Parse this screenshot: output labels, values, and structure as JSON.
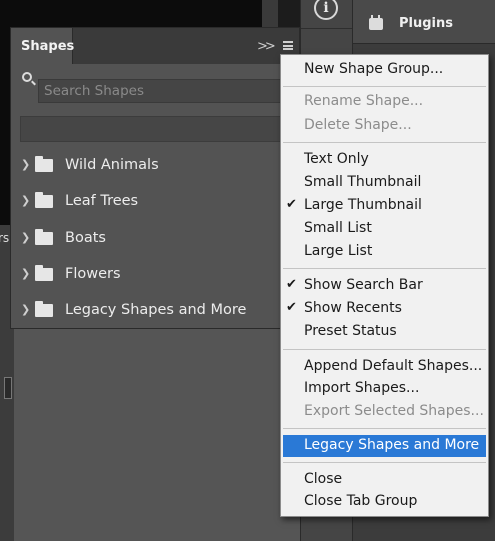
{
  "shapes_panel": {
    "tab_label": "Shapes",
    "search_placeholder": "Search Shapes",
    "groups": [
      {
        "label": "Wild Animals"
      },
      {
        "label": "Leaf Trees"
      },
      {
        "label": "Boats"
      },
      {
        "label": "Flowers"
      },
      {
        "label": "Legacy Shapes and More"
      }
    ]
  },
  "plugins_panel": {
    "label": "Plugins"
  },
  "left_fragment": {
    "text": "rs"
  },
  "context_menu": {
    "items": [
      {
        "label": "New Shape Group...",
        "enabled": true,
        "checked": false
      },
      {
        "label": "Rename Shape...",
        "enabled": false,
        "checked": false
      },
      {
        "label": "Delete Shape...",
        "enabled": false,
        "checked": false
      },
      {
        "label": "Text Only",
        "enabled": true,
        "checked": false
      },
      {
        "label": "Small Thumbnail",
        "enabled": true,
        "checked": false
      },
      {
        "label": "Large Thumbnail",
        "enabled": true,
        "checked": true
      },
      {
        "label": "Small List",
        "enabled": true,
        "checked": false
      },
      {
        "label": "Large List",
        "enabled": true,
        "checked": false
      },
      {
        "label": "Show Search Bar",
        "enabled": true,
        "checked": true
      },
      {
        "label": "Show Recents",
        "enabled": true,
        "checked": true
      },
      {
        "label": "Preset Status",
        "enabled": true,
        "checked": false
      },
      {
        "label": "Append Default Shapes...",
        "enabled": true,
        "checked": false
      },
      {
        "label": "Import Shapes...",
        "enabled": true,
        "checked": false
      },
      {
        "label": "Export Selected Shapes...",
        "enabled": false,
        "checked": false
      },
      {
        "label": "Legacy Shapes and More",
        "enabled": true,
        "checked": false,
        "highlighted": true
      },
      {
        "label": "Close",
        "enabled": true,
        "checked": false
      },
      {
        "label": "Close Tab Group",
        "enabled": true,
        "checked": false
      }
    ],
    "check_glyph": "✔"
  },
  "colors": {
    "highlight": "#2a79d6",
    "panel_bg": "#535353",
    "menu_bg": "#f1f1f1"
  }
}
